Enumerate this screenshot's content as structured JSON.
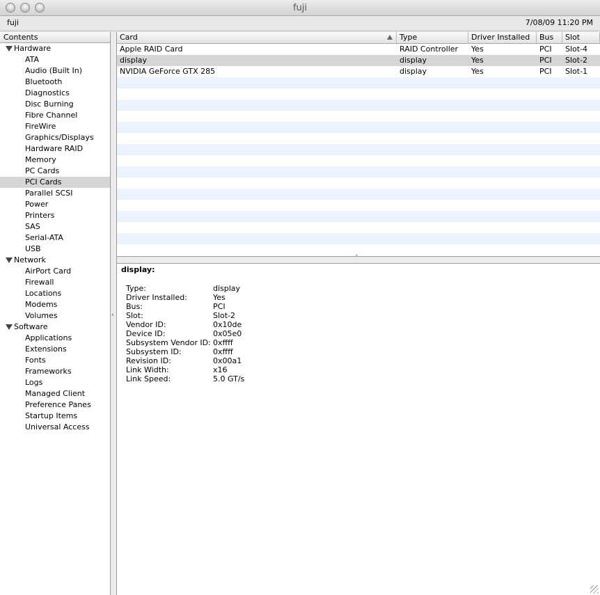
{
  "window": {
    "title": "fuji"
  },
  "infobar": {
    "machine_name": "fuji",
    "datetime": "7/08/09 11:20 PM"
  },
  "sidebar": {
    "header": "Contents",
    "groups": [
      {
        "label": "Hardware",
        "items": [
          "ATA",
          "Audio (Built In)",
          "Bluetooth",
          "Diagnostics",
          "Disc Burning",
          "Fibre Channel",
          "FireWire",
          "Graphics/Displays",
          "Hardware RAID",
          "Memory",
          "PC Cards",
          "PCI Cards",
          "Parallel SCSI",
          "Power",
          "Printers",
          "SAS",
          "Serial-ATA",
          "USB"
        ]
      },
      {
        "label": "Network",
        "items": [
          "AirPort Card",
          "Firewall",
          "Locations",
          "Modems",
          "Volumes"
        ]
      },
      {
        "label": "Software",
        "items": [
          "Applications",
          "Extensions",
          "Fonts",
          "Frameworks",
          "Logs",
          "Managed Client",
          "Preference Panes",
          "Startup Items",
          "Universal Access"
        ]
      }
    ],
    "selected_item": "PCI Cards"
  },
  "table": {
    "columns": [
      "Card",
      "Type",
      "Driver Installed",
      "Bus",
      "Slot"
    ],
    "sorted_column": "Card",
    "rows": [
      [
        "Apple RAID Card",
        "RAID Controller",
        "Yes",
        "PCI",
        "Slot-4"
      ],
      [
        "display",
        "display",
        "Yes",
        "PCI",
        "Slot-2"
      ],
      [
        "NVIDIA GeForce GTX 285",
        "display",
        "Yes",
        "PCI",
        "Slot-1"
      ]
    ],
    "selected_row": 1
  },
  "detail": {
    "title": "display:",
    "fields": [
      {
        "key": "Type:",
        "value": "display"
      },
      {
        "key": "Driver Installed:",
        "value": "Yes"
      },
      {
        "key": "Bus:",
        "value": "PCI"
      },
      {
        "key": "Slot:",
        "value": "Slot-2"
      },
      {
        "key": "Vendor ID:",
        "value": "0x10de"
      },
      {
        "key": "Device ID:",
        "value": "0x05e0"
      },
      {
        "key": "Subsystem Vendor ID:",
        "value": "0xffff"
      },
      {
        "key": "Subsystem ID:",
        "value": "0xffff"
      },
      {
        "key": "Revision ID:",
        "value": "0x00a1"
      },
      {
        "key": "Link Width:",
        "value": "x16"
      },
      {
        "key": "Link Speed:",
        "value": "5.0 GT/s"
      }
    ]
  },
  "colors": {
    "selection": "#d6d6d6",
    "stripe": "#edf3fe"
  },
  "icons": {
    "disclosure": "disclosure-triangle-icon",
    "sort": "sort-ascending-icon"
  }
}
